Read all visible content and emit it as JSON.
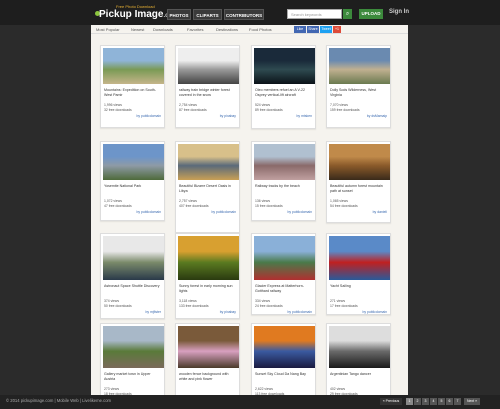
{
  "header": {
    "logo_tagline": "Free Photo Download",
    "logo_name": "Pickup Image",
    "logo_suffix": ".com",
    "nav": [
      "PHOTOS",
      "CLIPARTS",
      "CONTRIBUTORS"
    ],
    "search_placeholder": "Search keywords",
    "upload": "UPLOAD",
    "sign_in": "Sign In"
  },
  "subnav": [
    "Most Popular",
    "Newest",
    "Downloads",
    "Favorites",
    "Destinations",
    "Food Photos"
  ],
  "social": [
    "Like",
    "Share",
    "Tweet",
    "+1"
  ],
  "cards": [
    {
      "title": "Mountains: Expedition on South-West Pamir",
      "views": "1,996 views",
      "downloads": "32 free downloads",
      "by": "by publicdomain",
      "palette": [
        "#8fb4d8",
        "#7a9a55",
        "#c5b58a"
      ]
    },
    {
      "title": "railway train bridge winter forest covered in the snow",
      "views": "2,754 views",
      "downloads": "87 free downloads",
      "by": "by pixabay",
      "palette": [
        "#eeeeee",
        "#999999",
        "#444444"
      ]
    },
    {
      "title": "Oleo members refuel an A V-22 Osprey vertical-lift aircraft",
      "views": "524 views",
      "downloads": "89 free downloads",
      "by": "by mtsken",
      "palette": [
        "#1a2a3a",
        "#2e4a50",
        "#0b1218"
      ]
    },
    {
      "title": "Dolly Sods Wilderness, West Virginia",
      "views": "7,070 views",
      "downloads": "159 free downloads",
      "by": "by dsMamaip",
      "palette": [
        "#6a8ab0",
        "#c0b090",
        "#6a7a50"
      ]
    },
    {
      "title": "Yosemite National Park",
      "views": "1,072 views",
      "downloads": "47 free downloads",
      "by": "by publicdomain",
      "palette": [
        "#6d95c9",
        "#8e9aa6",
        "#4e6a3a"
      ]
    },
    {
      "title": "Beautiful Bizarre Desert Oasis in Libya",
      "views": "2,757 views",
      "downloads": "407 free downloads",
      "by": "by publicdomain",
      "palette": [
        "#d8c08a",
        "#5a6a7a",
        "#c9a055"
      ]
    },
    {
      "title": "Railway tracks by the beach",
      "views": "136 views",
      "downloads": "15 free downloads",
      "by": "by publicdomain",
      "palette": [
        "#b0c0d0",
        "#8a6a6a",
        "#c0a0a0"
      ]
    },
    {
      "title": "Beautiful autumn forest mountain path at sunset",
      "views": "1,065 views",
      "downloads": "54 free downloads",
      "by": "by danieli",
      "palette": [
        "#c08a4a",
        "#8a5a2a",
        "#3a2a1a"
      ]
    },
    {
      "title": "Astronaut Space Shuttle Discovery",
      "views": "374 views",
      "downloads": "50 free downloads",
      "by": "by mjfister",
      "palette": [
        "#e8e8e8",
        "#7a8a6a",
        "#2a3a4a"
      ]
    },
    {
      "title": "Sunny forest in early morning sun lights",
      "views": "3,118 views",
      "downloads": "133 free downloads",
      "by": "by pixabay",
      "palette": [
        "#d8a030",
        "#5a7a20",
        "#2a3a10"
      ]
    },
    {
      "title": "Glacier Express at Matterhorn-Gotthard railway",
      "views": "334 views",
      "downloads": "24 free downloads",
      "by": "by publicdomain",
      "palette": [
        "#8ab0d8",
        "#4a7a4a",
        "#b03030"
      ]
    },
    {
      "title": "Yacht Sailing",
      "views": "271 views",
      "downloads": "17 free downloads",
      "by": "by publicdomain",
      "palette": [
        "#5a8ac8",
        "#c02020",
        "#2a5a9a"
      ]
    },
    {
      "title": "Gallery market town in Upper Austria",
      "views": "273 views",
      "downloads": "18 free downloads",
      "by": "",
      "palette": [
        "#a8b8c8",
        "#5a7a3a",
        "#7a6a5a"
      ]
    },
    {
      "title": "wooden fence background with white and pink flower",
      "views": "",
      "downloads": "",
      "by": "",
      "palette": [
        "#7a5a3a",
        "#d8a0c0",
        "#4a3a2a"
      ]
    },
    {
      "title": "Sunset Sky Cloud Da Nang Bay",
      "views": "2,622 views",
      "downloads": "113 free downloads",
      "by": "by pixabay",
      "palette": [
        "#e07a20",
        "#3a5aa0",
        "#1a1a40"
      ]
    },
    {
      "title": "Argentinian Tango dancer",
      "views": "402 views",
      "downloads": "29 free downloads",
      "by": "by peoplesthol",
      "palette": [
        "#dddddd",
        "#6a6a6a",
        "#1a1a1a"
      ]
    }
  ],
  "footer": {
    "copyright": "© 2014 pickupimage.com | Mobile Web | Livelikeme.com",
    "pages": [
      "1",
      "2",
      "3",
      "4",
      "5",
      "6",
      "7"
    ],
    "next": "Next »",
    "prev": "« Previous"
  }
}
